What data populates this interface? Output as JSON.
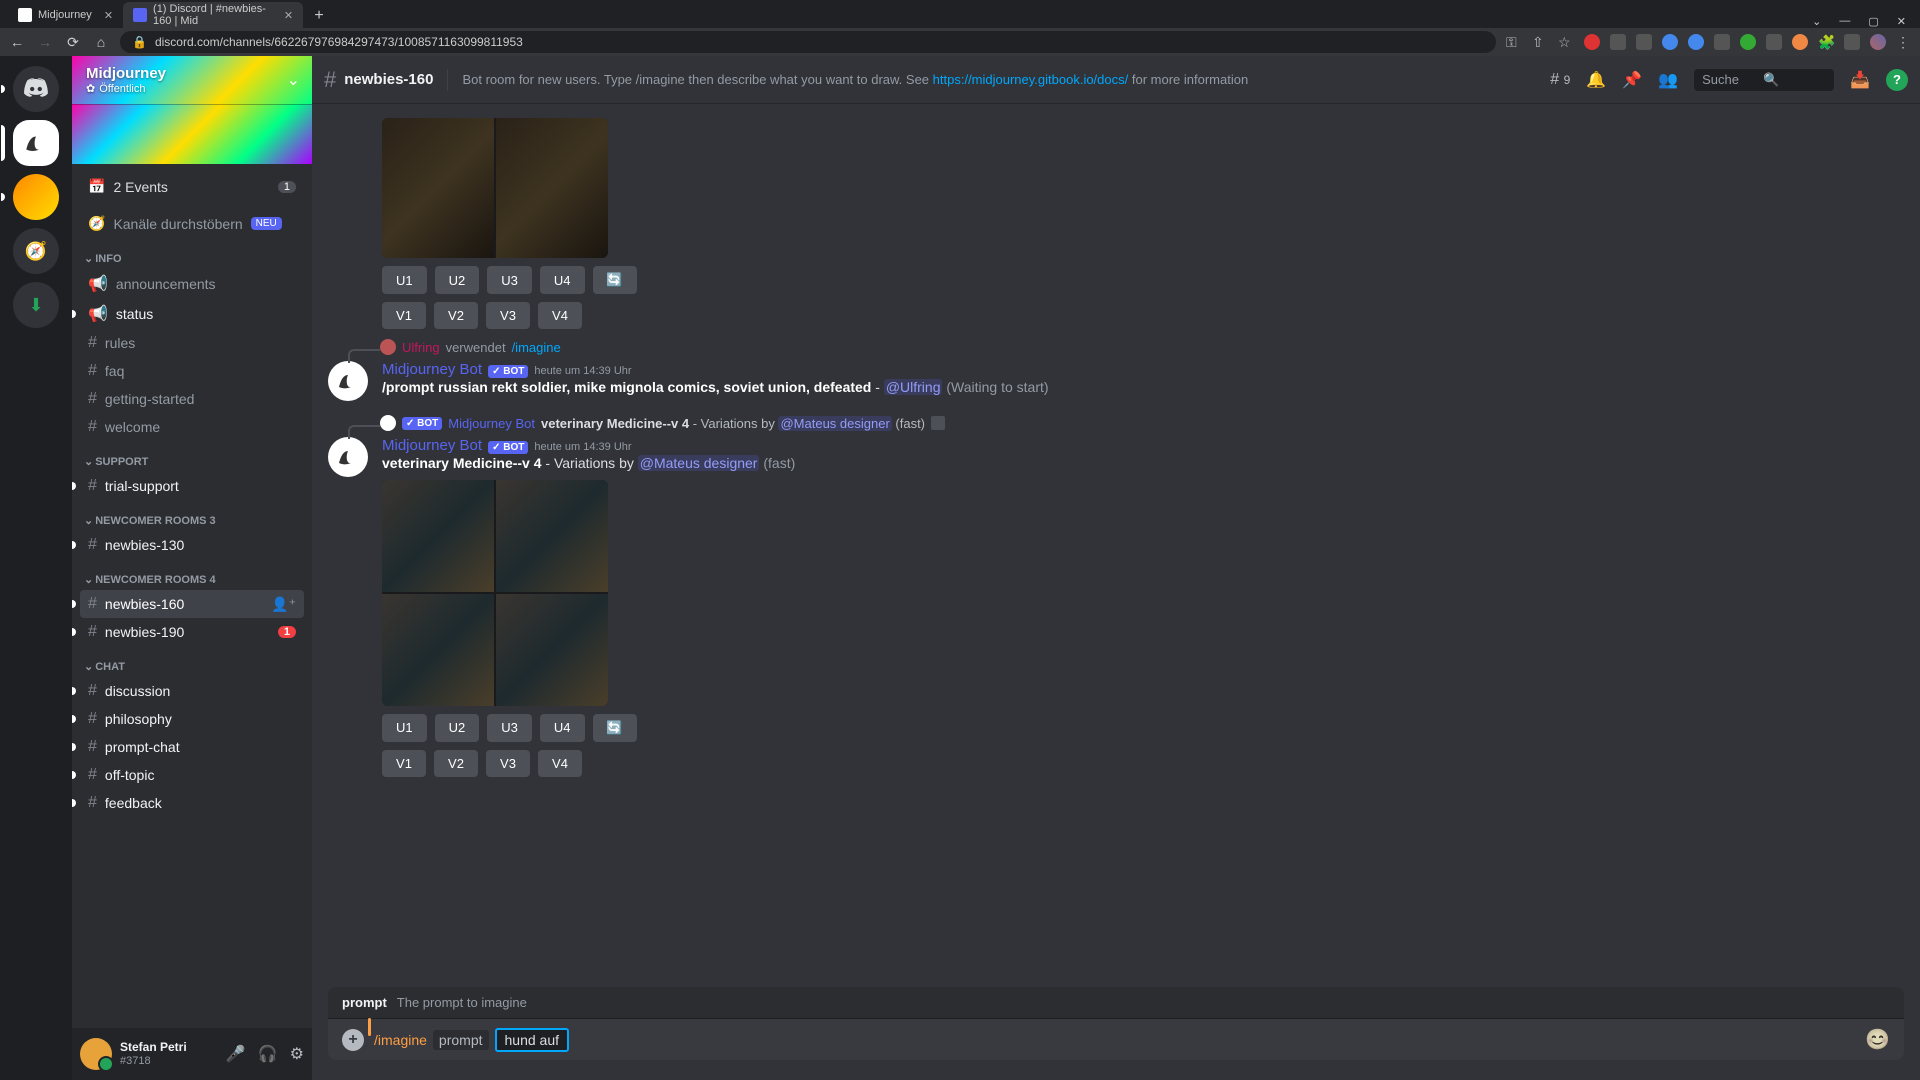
{
  "browser": {
    "tabs": [
      {
        "title": "Midjourney",
        "active": false
      },
      {
        "title": "(1) Discord | #newbies-160 | Mid",
        "active": true
      }
    ],
    "url": "discord.com/channels/662267976984297473/1008571163099811953",
    "window": {
      "dropdown": "⌄",
      "min": "—",
      "max": "▢",
      "close": "✕"
    }
  },
  "server": {
    "name": "Midjourney",
    "visibility": "Öffentlich"
  },
  "events": {
    "label": "2 Events",
    "count": "1"
  },
  "browse": {
    "label": "Kanäle durchstöbern",
    "badge": "NEU"
  },
  "categories": {
    "info": {
      "name": "INFO",
      "channels": [
        {
          "name": "announcements",
          "unread": false
        },
        {
          "name": "status",
          "unread": true
        },
        {
          "name": "rules",
          "unread": false
        },
        {
          "name": "faq",
          "unread": false
        },
        {
          "name": "getting-started",
          "unread": false
        },
        {
          "name": "welcome",
          "unread": false
        }
      ]
    },
    "support": {
      "name": "SUPPORT",
      "channels": [
        {
          "name": "trial-support",
          "unread": true
        }
      ]
    },
    "nr3": {
      "name": "NEWCOMER ROOMS 3",
      "channels": [
        {
          "name": "newbies-130",
          "unread": true
        }
      ]
    },
    "nr4": {
      "name": "NEWCOMER ROOMS 4",
      "channels": [
        {
          "name": "newbies-160",
          "unread": true,
          "selected": true
        },
        {
          "name": "newbies-190",
          "unread": true,
          "mentions": "1"
        }
      ]
    },
    "chat": {
      "name": "CHAT",
      "channels": [
        {
          "name": "discussion",
          "unread": true
        },
        {
          "name": "philosophy",
          "unread": true
        },
        {
          "name": "prompt-chat",
          "unread": true
        },
        {
          "name": "off-topic",
          "unread": true
        },
        {
          "name": "feedback",
          "unread": true
        }
      ]
    }
  },
  "user_panel": {
    "name": "Stefan Petri",
    "tag": "#3718"
  },
  "header": {
    "channel": "newbies-160",
    "topic_pre": "Bot room for new users. Type /imagine then describe what you want to draw. See ",
    "topic_link": "https://midjourney.gitbook.io/docs/",
    "topic_post": " for more information",
    "thread_count": "9",
    "search_placeholder": "Suche"
  },
  "messages": {
    "btns": {
      "u1": "U1",
      "u2": "U2",
      "u3": "U3",
      "u4": "U4",
      "v1": "V1",
      "v2": "V2",
      "v3": "V3",
      "v4": "V4"
    },
    "reply1": {
      "user": "Ulfring",
      "verb": "verwendet",
      "cmd": "/imagine"
    },
    "m1": {
      "author": "Midjourney Bot",
      "time": "heute um 14:39 Uhr",
      "prompt_bold": "/prompt russian rekt soldier, mike mignola comics, soviet union, defeated",
      "dash": " - ",
      "mention": "@Ulfring",
      "status": " (Waiting to start)"
    },
    "reply2": {
      "author": "Midjourney Bot",
      "text_bold": "veterinary Medicine--v 4",
      "text_mid": " - Variations by ",
      "mention": "@Mateus designer",
      "text_end": " (fast)"
    },
    "m2": {
      "author": "Midjourney Bot",
      "time": "heute um 14:39 Uhr",
      "prompt_bold": "veterinary Medicine--v 4",
      "mid": " - Variations by ",
      "mention": "@Mateus designer",
      "status": " (fast)"
    }
  },
  "input": {
    "hint_name": "prompt",
    "hint_desc": "The prompt to imagine",
    "command": "/imagine",
    "param": "prompt",
    "value": "hund auf"
  }
}
